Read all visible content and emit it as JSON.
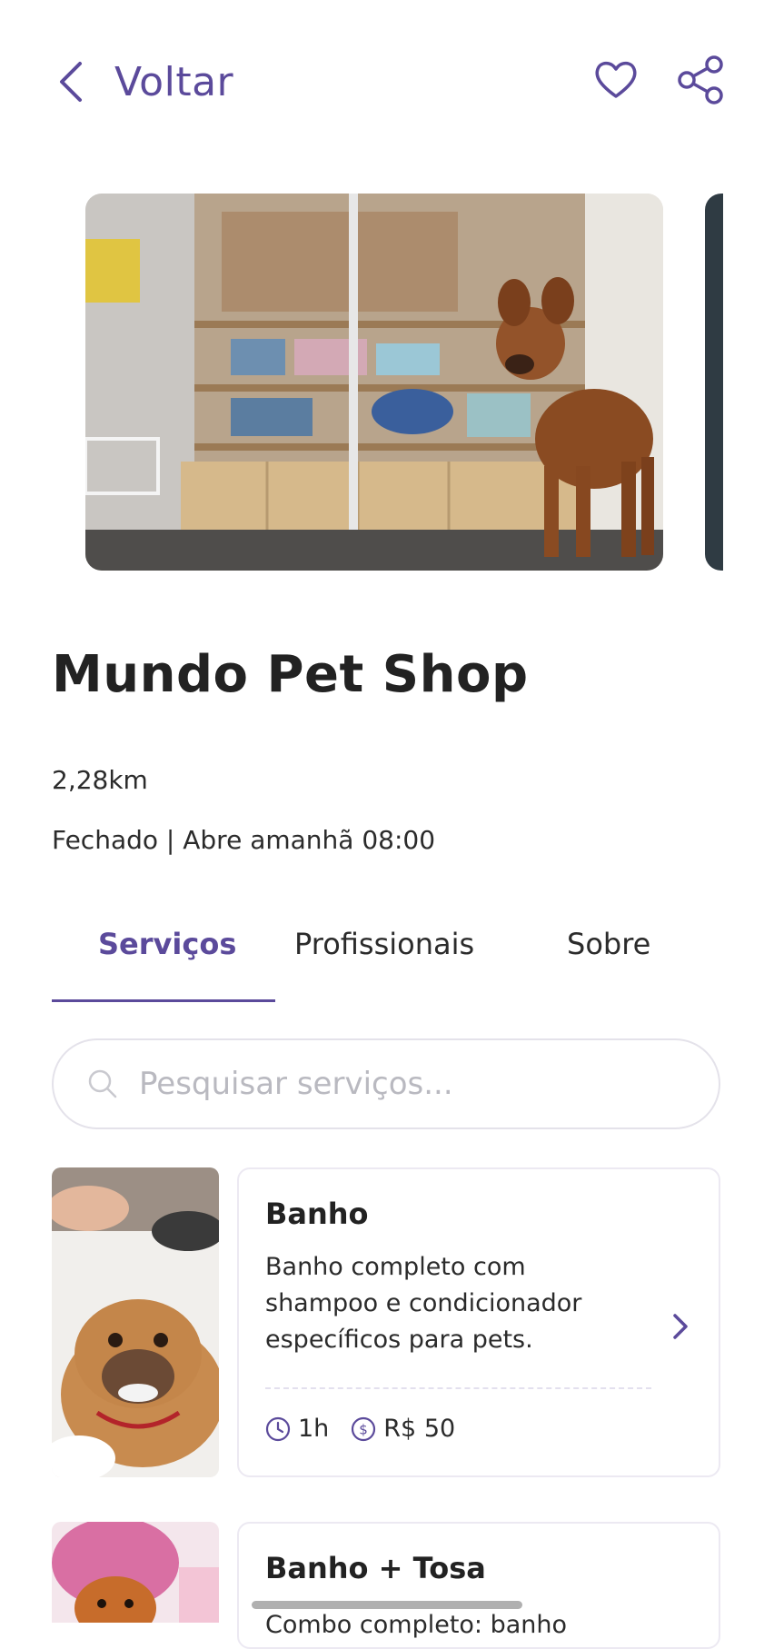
{
  "header": {
    "back_label": "Voltar",
    "favorite_icon": "heart-icon",
    "share_icon": "share-icon",
    "accent_color": "#5b4a9b"
  },
  "store": {
    "name": "Mundo Pet Shop",
    "distance": "2,28km",
    "status": "Fechado | Abre amanhã 08:00"
  },
  "tabs": [
    {
      "label": "Serviços",
      "active": true
    },
    {
      "label": "Profissionais",
      "active": false
    },
    {
      "label": "Sobre",
      "active": false
    }
  ],
  "search": {
    "placeholder": "Pesquisar serviços...",
    "value": ""
  },
  "services": [
    {
      "title": "Banho",
      "description": "Banho completo com shampoo e condicionador específicos para pets.",
      "duration": "1h",
      "price": "R$ 50"
    },
    {
      "title": "Banho + Tosa",
      "description": "Combo completo: banho"
    }
  ]
}
